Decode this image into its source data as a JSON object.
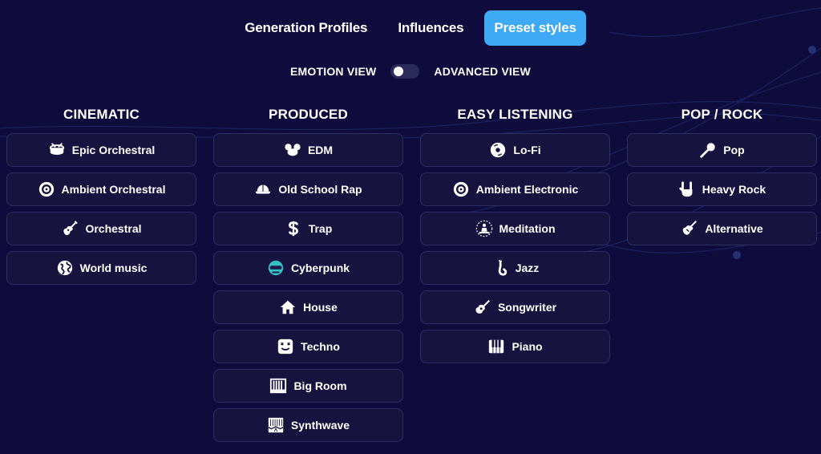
{
  "tabs": [
    {
      "label": "Generation Profiles",
      "active": false
    },
    {
      "label": "Influences",
      "active": false
    },
    {
      "label": "Preset styles",
      "active": true
    }
  ],
  "view_toggle": {
    "left_label": "EMOTION VIEW",
    "right_label": "ADVANCED VIEW",
    "state": "emotion"
  },
  "columns": [
    {
      "title": "CINEMATIC",
      "items": [
        {
          "label": "Epic Orchestral",
          "icon": "drum-icon"
        },
        {
          "label": "Ambient Orchestral",
          "icon": "vinyl-icon"
        },
        {
          "label": "Orchestral",
          "icon": "guitar-icon"
        },
        {
          "label": "World music",
          "icon": "globe-icon"
        }
      ]
    },
    {
      "title": "PRODUCED",
      "items": [
        {
          "label": "EDM",
          "icon": "mouse-head-icon"
        },
        {
          "label": "Old School Rap",
          "icon": "cap-icon"
        },
        {
          "label": "Trap",
          "icon": "dollar-icon"
        },
        {
          "label": "Cyberpunk",
          "icon": "helmet-icon"
        },
        {
          "label": "House",
          "icon": "house-icon"
        },
        {
          "label": "Techno",
          "icon": "smiley-x-icon"
        },
        {
          "label": "Big Room",
          "icon": "keyboard-icon"
        },
        {
          "label": "Synthwave",
          "icon": "synthwave-icon"
        }
      ]
    },
    {
      "title": "EASY LISTENING",
      "items": [
        {
          "label": "Lo-Fi",
          "icon": "cd-icon"
        },
        {
          "label": "Ambient Electronic",
          "icon": "vinyl-icon"
        },
        {
          "label": "Meditation",
          "icon": "meditation-icon"
        },
        {
          "label": "Jazz",
          "icon": "saxophone-icon"
        },
        {
          "label": "Songwriter",
          "icon": "acoustic-guitar-icon"
        },
        {
          "label": "Piano",
          "icon": "piano-icon"
        }
      ]
    },
    {
      "title": "POP / ROCK",
      "items": [
        {
          "label": "Pop",
          "icon": "microphone-icon"
        },
        {
          "label": "Heavy Rock",
          "icon": "rock-hand-icon"
        },
        {
          "label": "Alternative",
          "icon": "electric-guitar-icon"
        }
      ]
    }
  ],
  "colors": {
    "background": "#0f0c3d",
    "accent": "#3ea9f5",
    "button_bg": "#16143f",
    "cyberpunk_icon": "#35c1c4"
  }
}
